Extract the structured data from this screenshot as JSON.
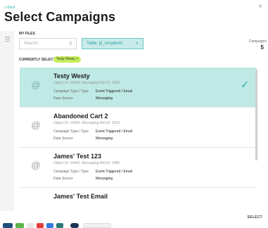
{
  "nav": {
    "back": "< Back",
    "close": "×"
  },
  "title": "Select Campaigns",
  "myfiles": "MY FILES",
  "search": {
    "placeholder": "Search...",
    "icon": "search-icon"
  },
  "table_select": {
    "value": "Table: jd_recipients",
    "icon": "chevron-down-icon"
  },
  "campaigns": {
    "label": "Campaigns",
    "count": "5"
  },
  "currently_selected": {
    "label": "CURRENTLY SELECTED",
    "badge": "Testy Westy ×"
  },
  "cards": [
    {
      "name": "Testy Westy",
      "object": "Object ID: 14924, Messaging Ref ID: 3092",
      "type_label": "Campaign Type / Type",
      "type_value": "Event Triggered / Email",
      "source_label": "Data Source",
      "source_value": "Messaging",
      "selected": true
    },
    {
      "name": "Abandoned Cart 2",
      "object": "Object ID: 14683, Messaging Ref ID: 3019",
      "type_label": "Campaign Type / Type",
      "type_value": "Event Triggered / Email",
      "source_label": "Data Source",
      "source_value": "Messaging",
      "selected": false
    },
    {
      "name": "James' Test 123",
      "object": "Object ID: 14441, Messaging Ref ID: 2985",
      "type_label": "Campaign Type / Type",
      "type_value": "Event Triggered / Email",
      "source_label": "Data Source",
      "source_value": "Messaging",
      "selected": false
    },
    {
      "name": "James' Test Email",
      "object": "",
      "type_label": "",
      "type_value": "",
      "source_label": "",
      "source_value": "",
      "selected": false
    }
  ],
  "select_button": "SELECT",
  "colors": {
    "accent": "#2bb3b1",
    "selected_bg": "#bfe9e5",
    "badge": "#c6ee5b"
  }
}
